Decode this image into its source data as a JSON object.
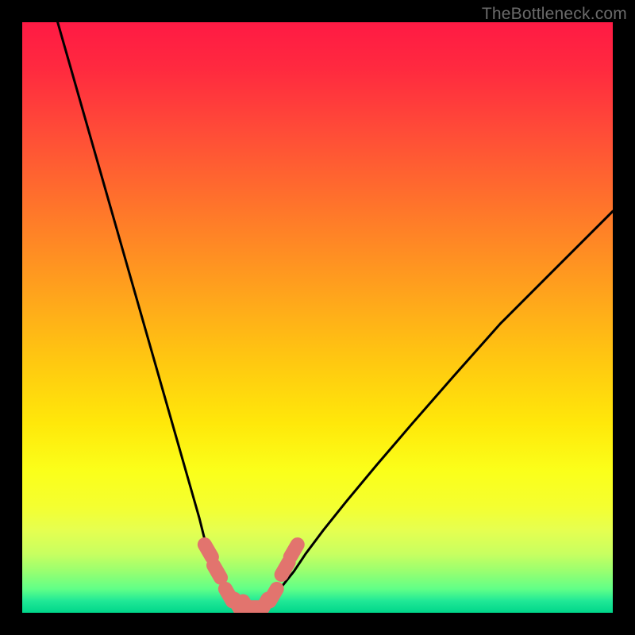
{
  "watermark": "TheBottleneck.com",
  "colors": {
    "frame": "#000000",
    "curve_stroke": "#000000",
    "marker_fill": "#e2746e",
    "marker_stroke": "#c85a54",
    "gradient_top": "#ff1a44",
    "gradient_bottom": "#00d68a"
  },
  "chart_data": {
    "type": "line",
    "title": "",
    "xlabel": "",
    "ylabel": "",
    "xlim": [
      0,
      100
    ],
    "ylim": [
      0,
      100
    ],
    "grid": false,
    "legend": false,
    "curve_left": {
      "x": [
        6,
        8,
        10,
        12,
        14,
        16,
        18,
        20,
        22,
        24,
        26,
        28,
        30,
        31,
        32,
        33,
        34,
        35,
        36,
        37
      ],
      "y": [
        100,
        93,
        86,
        79,
        72,
        65,
        58,
        51,
        44,
        37,
        30,
        23,
        16,
        12,
        9,
        6.5,
        4.5,
        3,
        1.8,
        1
      ]
    },
    "curve_right": {
      "x": [
        41,
        42,
        43,
        44,
        46,
        48,
        51,
        55,
        60,
        66,
        73,
        81,
        90,
        100
      ],
      "y": [
        1,
        1.8,
        3,
        4.5,
        7,
        10,
        14,
        19,
        25,
        32,
        40,
        49,
        58,
        68
      ]
    },
    "floor_segment": {
      "x": [
        37,
        41
      ],
      "y": [
        1,
        1
      ]
    },
    "markers": [
      {
        "x": 31.5,
        "y": 10.5
      },
      {
        "x": 33.0,
        "y": 7.0
      },
      {
        "x": 35.0,
        "y": 3.0
      },
      {
        "x": 36.5,
        "y": 1.3
      },
      {
        "x": 38.0,
        "y": 0.9
      },
      {
        "x": 39.5,
        "y": 0.9
      },
      {
        "x": 41.0,
        "y": 1.3
      },
      {
        "x": 42.5,
        "y": 3.0
      },
      {
        "x": 44.5,
        "y": 7.5
      },
      {
        "x": 46.0,
        "y": 10.5
      }
    ]
  }
}
